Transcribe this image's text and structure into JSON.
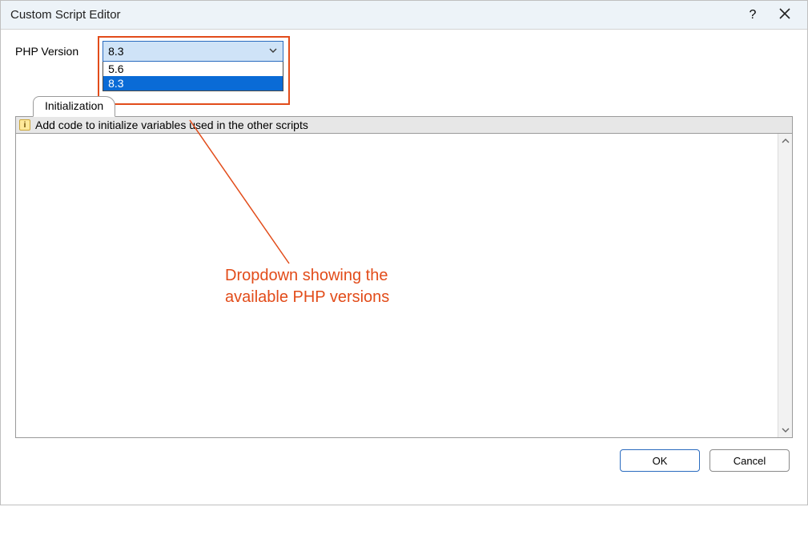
{
  "window": {
    "title": "Custom Script Editor"
  },
  "php": {
    "label": "PHP Version",
    "selected": "8.3",
    "options": [
      "5.6",
      "8.3"
    ],
    "highlighted": "8.3"
  },
  "tabs": {
    "active": "Initialization"
  },
  "info": {
    "text": "Add code to initialize variables used in the other scripts"
  },
  "editor": {
    "content": ""
  },
  "buttons": {
    "ok": "OK",
    "cancel": "Cancel"
  },
  "annotation": {
    "line1": "Dropdown showing the",
    "line2": "available PHP versions"
  }
}
